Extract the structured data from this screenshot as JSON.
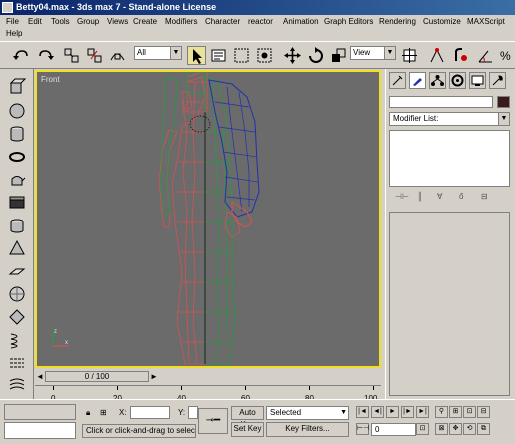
{
  "window": {
    "title": "Betty04.max - 3ds max 7 - Stand-alone License"
  },
  "menu": {
    "items": [
      "File",
      "Edit",
      "Tools",
      "Group",
      "Views",
      "Create",
      "Modifiers",
      "Character",
      "reactor",
      "Animation",
      "Graph Editors",
      "Rendering",
      "Customize",
      "MAXScript",
      "Help"
    ]
  },
  "toolbar": {
    "selection_filter": "All",
    "ref_coord": "View"
  },
  "viewport": {
    "label": "Front",
    "colors": {
      "left_mesh": "#e05050",
      "right_mesh": "#20a040",
      "arm_mesh": "#2030b0",
      "border": "#f0e020",
      "background": "#6b6b6b"
    }
  },
  "timeline": {
    "slider": "0 / 100",
    "ticks": [
      "0",
      "20",
      "40",
      "60",
      "80",
      "100"
    ]
  },
  "command_panel": {
    "modifier_list": "Modifier List:"
  },
  "status": {
    "x_label": "X:",
    "y_label": "Y:",
    "prompt": "Click or click-and-drag to select o",
    "auto_key": "Auto Key",
    "set_key": "Set Key",
    "key_mode": "Selected",
    "key_filters": "Key Filters...",
    "frame": "0"
  }
}
